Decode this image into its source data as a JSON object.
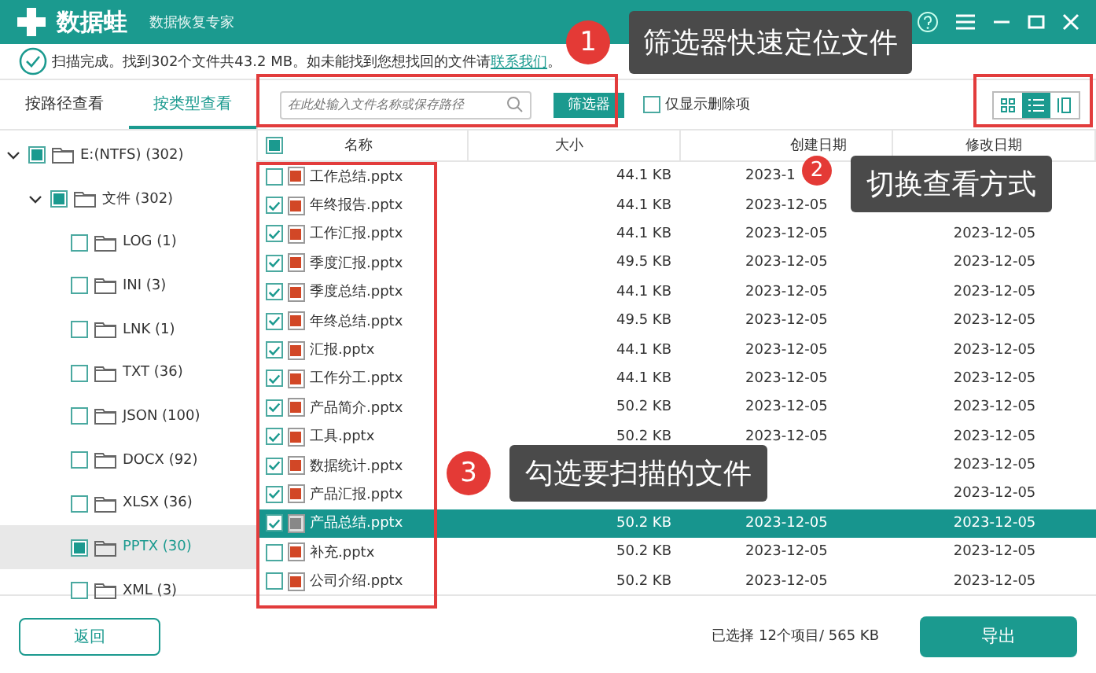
{
  "app": {
    "name": "数据蛙",
    "subtitle": "数据恢复专家"
  },
  "notice": {
    "text": "扫描完成。找到302个文件共43.2 MB。如未能找到您想找回的文件请",
    "link": "联系我们",
    "end": "。"
  },
  "view_tabs": [
    {
      "label": "按路径查看",
      "selected": false
    },
    {
      "label": "按类型查看",
      "selected": true
    }
  ],
  "search": {
    "placeholder": "在此处输入文件名称或保存路径"
  },
  "filter_button": "筛选器",
  "deleted_only": {
    "label": "仅显示删除项",
    "checked": false
  },
  "view_modes": [
    {
      "kind": "grid",
      "selected": false
    },
    {
      "kind": "list",
      "selected": true
    },
    {
      "kind": "detail",
      "selected": false
    }
  ],
  "tree": [
    {
      "label": "E:(NTFS) (302)",
      "partial": true,
      "checked": false,
      "selected": false,
      "expanded": true,
      "children": [
        {
          "label": "文件 (302)",
          "partial": true,
          "checked": false,
          "selected": false,
          "expanded": true,
          "children": [
            {
              "label": "LOG (1)",
              "partial": false,
              "checked": false,
              "selected": false
            },
            {
              "label": "INI (3)",
              "partial": false,
              "checked": false,
              "selected": false
            },
            {
              "label": "LNK (1)",
              "partial": false,
              "checked": false,
              "selected": false
            },
            {
              "label": "TXT (36)",
              "partial": false,
              "checked": false,
              "selected": false
            },
            {
              "label": "JSON (100)",
              "partial": false,
              "checked": false,
              "selected": false
            },
            {
              "label": "DOCX (92)",
              "partial": false,
              "checked": false,
              "selected": false
            },
            {
              "label": "XLSX (36)",
              "partial": false,
              "checked": false,
              "selected": false
            },
            {
              "label": "PPTX (30)",
              "partial": true,
              "checked": false,
              "selected": true
            },
            {
              "label": "XML (3)",
              "partial": false,
              "checked": false,
              "selected": false
            }
          ]
        }
      ]
    }
  ],
  "table": {
    "all_partial": true,
    "columns": [
      "名称",
      "大小",
      "创建日期",
      "修改日期"
    ],
    "rows": [
      {
        "name": "工作总结.pptx",
        "size": "44.1 KB",
        "created": "2023-1",
        "checked": false,
        "selected": false
      },
      {
        "name": "年终报告.pptx",
        "size": "44.1 KB",
        "created": "2023-12-05",
        "checked": true,
        "selected": false
      },
      {
        "name": "工作汇报.pptx",
        "size": "44.1 KB",
        "created": "2023-12-05",
        "modified": "2023-12-05",
        "checked": true,
        "selected": false
      },
      {
        "name": "季度汇报.pptx",
        "size": "49.5 KB",
        "created": "2023-12-05",
        "modified": "2023-12-05",
        "checked": true,
        "selected": false
      },
      {
        "name": "季度总结.pptx",
        "size": "44.1 KB",
        "created": "2023-12-05",
        "modified": "2023-12-05",
        "checked": true,
        "selected": false
      },
      {
        "name": "年终总结.pptx",
        "size": "49.5 KB",
        "created": "2023-12-05",
        "modified": "2023-12-05",
        "checked": true,
        "selected": false
      },
      {
        "name": "汇报.pptx",
        "size": "44.1 KB",
        "created": "2023-12-05",
        "modified": "2023-12-05",
        "checked": true,
        "selected": false
      },
      {
        "name": "工作分工.pptx",
        "size": "44.1 KB",
        "created": "2023-12-05",
        "modified": "2023-12-05",
        "checked": true,
        "selected": false
      },
      {
        "name": "产品简介.pptx",
        "size": "50.2 KB",
        "created": "2023-12-05",
        "modified": "2023-12-05",
        "checked": true,
        "selected": false
      },
      {
        "name": "工具.pptx",
        "size": "50.2 KB",
        "created": "2023-12-05",
        "modified": "2023-12-05",
        "checked": true,
        "selected": false
      },
      {
        "name": "数据统计.pptx",
        "modified": "2023-12-05",
        "checked": true,
        "selected": false
      },
      {
        "name": "产品汇报.pptx",
        "modified": "2023-12-05",
        "checked": true,
        "selected": false
      },
      {
        "name": "产品总结.pptx",
        "size": "50.2 KB",
        "created": "2023-12-05",
        "modified": "2023-12-05",
        "checked": true,
        "selected": true
      },
      {
        "name": "补充.pptx",
        "size": "50.2 KB",
        "created": "2023-12-05",
        "modified": "2023-12-05",
        "checked": false,
        "selected": false
      },
      {
        "name": "公司介绍.pptx",
        "size": "50.2 KB",
        "created": "2023-12-05",
        "modified": "2023-12-05",
        "checked": false,
        "selected": false
      }
    ]
  },
  "footer": {
    "back_button": "返回",
    "summary": "已选择 12个项目/ 565 KB",
    "export_button": "导出"
  },
  "callouts": [
    {
      "number": "1",
      "text": "筛选器快速定位文件"
    },
    {
      "number": "2",
      "text": "切换查看方式"
    },
    {
      "number": "3",
      "text": "勾选要扫描的文件"
    }
  ]
}
